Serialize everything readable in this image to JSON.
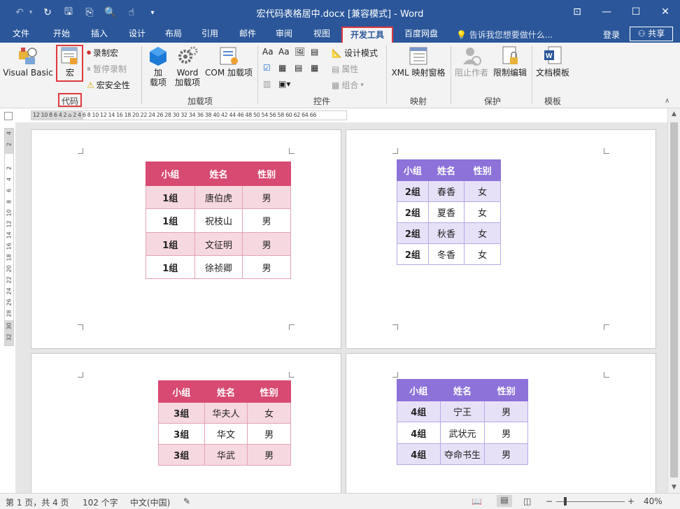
{
  "window": {
    "title": "宏代码表格居中.docx [兼容模式] - Word",
    "controls": [
      "ribbon-display",
      "minimize",
      "maximize",
      "close"
    ],
    "control_glyphs": [
      "⊡",
      "—",
      "☐",
      "✕"
    ]
  },
  "qat": {
    "undo_glyph": "↶",
    "redo_glyph": "▾",
    "sync_glyph": "↻",
    "save_glyph": "🖫",
    "format_glyph": "⎘",
    "preview_glyph": "🔍",
    "touch_glyph": "☝",
    "more_glyph": "▾"
  },
  "tabs": [
    "文件",
    "开始",
    "插入",
    "设计",
    "布局",
    "引用",
    "邮件",
    "审阅",
    "视图",
    "开发工具",
    "百度网盘"
  ],
  "active_tab": "开发工具",
  "tell_me": "告诉我您想要做什么...",
  "login": "登录",
  "share": "共享",
  "ribbon": {
    "code": {
      "visual_basic": "Visual Basic",
      "macro": "宏",
      "record_macro": "录制宏",
      "pause_recording": "暂停录制",
      "macro_security": "宏安全性",
      "group": "代码"
    },
    "addins": {
      "addins_line1": "加",
      "addins_line2": "载项",
      "word_line1": "Word",
      "word_line2": "加载项",
      "com": "COM 加载项",
      "group": "加载项"
    },
    "controls": {
      "design_mode": "设计模式",
      "properties": "属性",
      "group_btn": "组合",
      "group": "控件"
    },
    "mapping": {
      "xml": "XML 映射窗格",
      "group": "映射"
    },
    "protect": {
      "block_authors": "阻止作者",
      "restrict_editing": "限制编辑",
      "group": "保护"
    },
    "templates": {
      "document_template": "文档模板",
      "group": "模板"
    }
  },
  "ruler": {
    "horizontal": "12 10  8  6  4  2  ⌂  2  4  6  8 10 12 14 16 18 20 22 24 26 28 30 32 34 36 38 40 42 44 46 48 50   54 56 58 60 62 64 66",
    "vertical": [
      "4",
      "2",
      "2",
      "4",
      "6",
      "8",
      "10",
      "12",
      "14",
      "16",
      "18",
      "20",
      "22",
      "24",
      "26",
      "28",
      "30",
      "32"
    ]
  },
  "tables": [
    {
      "style": "pink",
      "headers": [
        "小组",
        "姓名",
        "性别"
      ],
      "rows": [
        [
          "1组",
          "唐伯虎",
          "男"
        ],
        [
          "1组",
          "祝枝山",
          "男"
        ],
        [
          "1组",
          "文征明",
          "男"
        ],
        [
          "1组",
          "徐祯卿",
          "男"
        ]
      ]
    },
    {
      "style": "purple",
      "headers": [
        "小组",
        "姓名",
        "性别"
      ],
      "rows": [
        [
          "2组",
          "春香",
          "女"
        ],
        [
          "2组",
          "夏香",
          "女"
        ],
        [
          "2组",
          "秋香",
          "女"
        ],
        [
          "2组",
          "冬香",
          "女"
        ]
      ]
    },
    {
      "style": "pink",
      "headers": [
        "小组",
        "姓名",
        "性别"
      ],
      "rows": [
        [
          "3组",
          "华夫人",
          "女"
        ],
        [
          "3组",
          "华文",
          "男"
        ],
        [
          "3组",
          "华武",
          "男"
        ]
      ]
    },
    {
      "style": "purple",
      "headers": [
        "小组",
        "姓名",
        "性别"
      ],
      "rows": [
        [
          "4组",
          "宁王",
          "男"
        ],
        [
          "4组",
          "武状元",
          "男"
        ],
        [
          "4组",
          "夺命书生",
          "男"
        ]
      ]
    }
  ],
  "colors": {
    "word_blue": "#2b579a",
    "highlight_red": "#e0393e",
    "pink_header": "#d74a72",
    "pink_alt": "#f6d8e0",
    "purple_header": "#8c72d9",
    "purple_alt": "#e7e1f8"
  },
  "status": {
    "page": "第 1 页，共 4 页",
    "words": "102 个字",
    "language": "中文(中国)",
    "zoom": "40%",
    "zoom_minus": "−",
    "zoom_plus": "+",
    "proofing_glyph": "✎"
  }
}
